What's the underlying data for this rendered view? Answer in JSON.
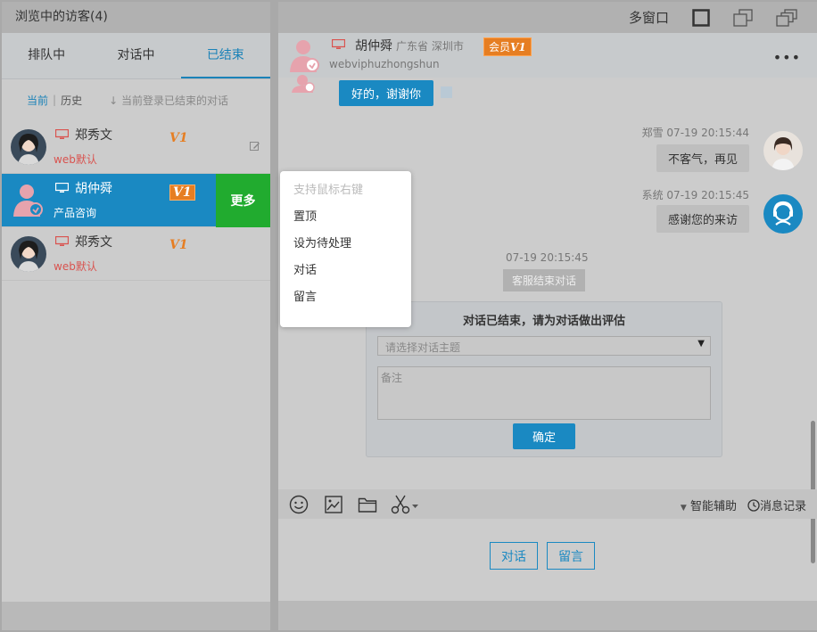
{
  "left": {
    "title": "浏览中的访客(4)",
    "tabs": [
      {
        "label": "排队中",
        "active": false
      },
      {
        "label": "对话中",
        "active": false
      },
      {
        "label": "已结束",
        "active": true
      }
    ],
    "filter": {
      "current": "当前",
      "separator": "|",
      "history": "历史",
      "hint": "↓ 当前登录已结束的对话"
    },
    "visitors": [
      {
        "name": "郑秀文",
        "tag": "web默认",
        "vip": "V1",
        "device_icon": "desktop-icon"
      },
      {
        "name": "胡仲舜",
        "tag": "产品咨询",
        "vip": "V1",
        "device_icon": "desktop-icon",
        "selected": true
      },
      {
        "name": "郑秀文",
        "tag": "web默认",
        "vip": "V1",
        "device_icon": "desktop-icon"
      }
    ],
    "more_label": "更多"
  },
  "context_menu": {
    "items": [
      {
        "label": "支持鼠标右键",
        "disabled": true
      },
      {
        "label": "置顶"
      },
      {
        "label": "设为待处理"
      },
      {
        "label": "对话"
      },
      {
        "label": "留言"
      }
    ]
  },
  "right": {
    "topbar": {
      "multi_window": "多窗口"
    },
    "header": {
      "name": "胡仲舜",
      "location": "广东省 深圳市",
      "member_label": "会员",
      "member_level": "V1",
      "visitor_id": "webviphuzhongshun",
      "more": "•••"
    },
    "messages": [
      {
        "type": "visitor",
        "text": "好的，谢谢你"
      },
      {
        "type": "agent",
        "sender": "郑雪",
        "time": "07-19 20:15:44",
        "text": "不客气，再见"
      },
      {
        "type": "system",
        "sender": "系统",
        "time": "07-19 20:15:45",
        "text": "感谢您的来访"
      }
    ],
    "end_note": {
      "time": "07-19 20:15:45",
      "text": "客服结束对话"
    },
    "evaluation": {
      "title": "对话已结束，请为对话做出评估",
      "topic_placeholder": "请选择对话主题",
      "notes_placeholder": "备注",
      "confirm": "确定"
    },
    "toolbar": {
      "assist": "智能辅助",
      "history": "消息记录"
    },
    "actions": {
      "chat": "对话",
      "message": "留言"
    }
  },
  "colors": {
    "accent": "#1a89c2",
    "more_green": "#21ab2f",
    "vip_orange": "#e67e22",
    "tag_red": "#d9534f"
  }
}
